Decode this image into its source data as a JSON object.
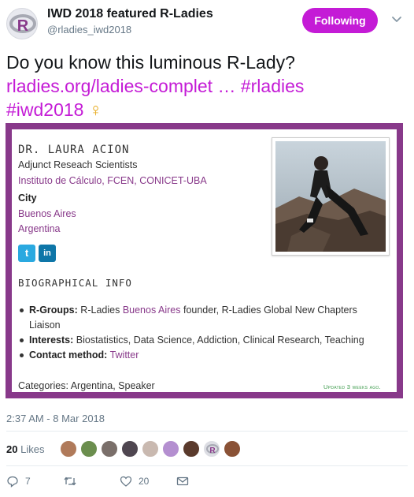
{
  "account": {
    "name": "IWD 2018 featured R-Ladies",
    "handle": "@rladies_iwd2018",
    "avatar_letter": "R",
    "follow_label": "Following",
    "brand_color": "#c41bd6"
  },
  "tweet": {
    "text_prefix": "Do you know this luminous R-Lady?",
    "link_text": "rladies.org/ladies-complet …",
    "hashtag1": "#rladies",
    "hashtag2": "#iwd2018",
    "emoji": "♀",
    "timestamp": "2:37 AM - 8 Mar 2018"
  },
  "card": {
    "border_color": "#88398a",
    "name": "DR. LAURA ACION",
    "title": "Adjunct Reseach Scientists",
    "institution": "Instituto de Cálculo, FCEN, CONICET-UBA",
    "city_heading": "City",
    "city": "Buenos Aires",
    "country": "Argentina",
    "twitter_icon": "t",
    "linkedin_icon": "in",
    "bio_heading": "BIOGRAPHICAL INFO",
    "rgroups_label": "R-Groups:",
    "rgroups_pre": "R-Ladies",
    "rgroups_link": "Buenos Aires",
    "rgroups_post": "founder, R-Ladies Global New Chapters Liaison",
    "interests_label": "Interests:",
    "interests": "Biostatistics, Data Science, Addiction, Clinical Research, Teaching",
    "contact_label": "Contact method:",
    "contact": "Twitter",
    "categories": "Categories: Argentina, Speaker",
    "updated": "Updated 3 weeks ago."
  },
  "likes": {
    "count": "20",
    "label": "Likes"
  },
  "actions": {
    "replies": "7",
    "retweets": "",
    "likes": "20"
  }
}
